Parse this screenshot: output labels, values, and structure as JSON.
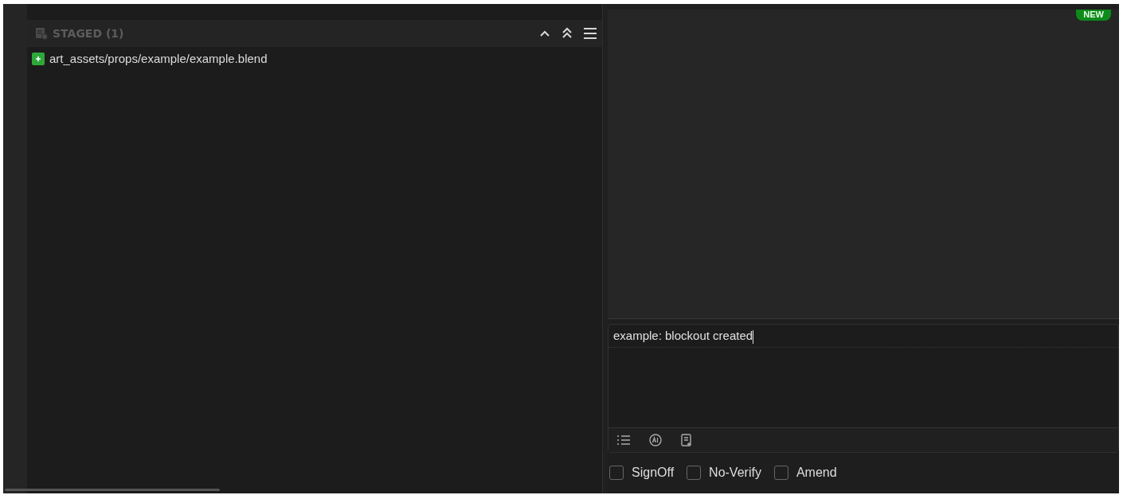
{
  "staged": {
    "title": "STAGED (1)",
    "files": [
      {
        "path": "art_assets/props/example/example.blend",
        "color": "#2fa83a"
      }
    ]
  },
  "badge": "NEW",
  "commit": {
    "message": "example: blockout created"
  },
  "options": [
    {
      "label": "SignOff",
      "checked": false
    },
    {
      "label": "No-Verify",
      "checked": false
    },
    {
      "label": "Amend",
      "checked": false
    }
  ]
}
